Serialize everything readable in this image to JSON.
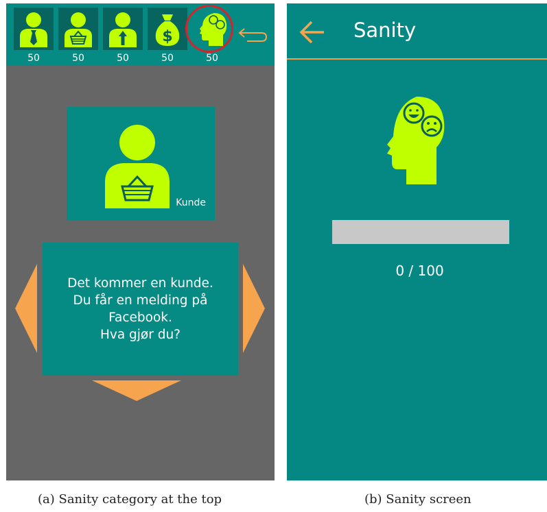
{
  "panel_a": {
    "stats": [
      {
        "icon": "businessman-icon",
        "value": "50"
      },
      {
        "icon": "customer-basket-icon",
        "value": "50"
      },
      {
        "icon": "employee-arrow-icon",
        "value": "50"
      },
      {
        "icon": "money-bag-icon",
        "value": "50"
      },
      {
        "icon": "sanity-head-icon",
        "value": "50"
      }
    ],
    "card": {
      "label": "Kunde",
      "icon": "customer-basket-icon"
    },
    "dialog": {
      "text": "Det kommer en kunde.\nDu får en melding på\nFacebook.\nHva gjør du?"
    },
    "caption": "(a) Sanity category at the top"
  },
  "panel_b": {
    "title": "Sanity",
    "progress": {
      "value": 0,
      "max": 100,
      "text": "0  / 100"
    },
    "caption": "(b) Sanity screen"
  },
  "colors": {
    "teal": "#068a84",
    "dark_teal": "#07645f",
    "lime": "#bfff00",
    "orange": "#f7a44e",
    "grey_bg": "#666666",
    "highlight_ring": "#d1262d"
  }
}
